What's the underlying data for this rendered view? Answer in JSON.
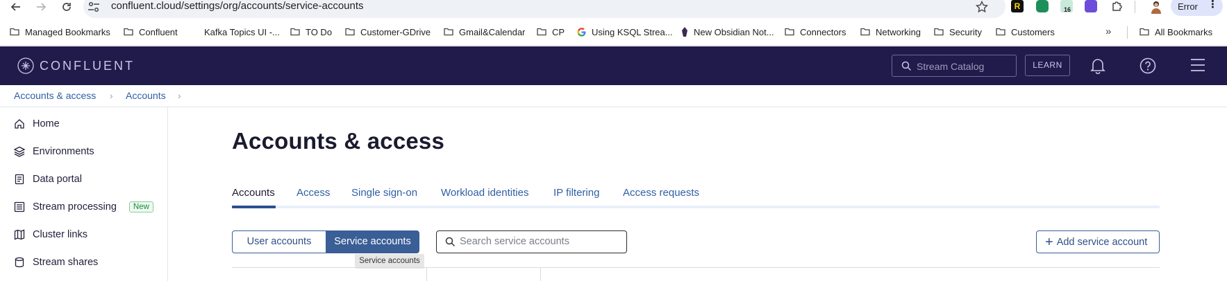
{
  "browser": {
    "url": "confluent.cloud/settings/org/accounts/service-accounts",
    "extension_r_label": "R",
    "extension_badge": "16",
    "error_label": "Error",
    "bookmarks": [
      {
        "label": "Managed Bookmarks",
        "icon": "folder-icon"
      },
      {
        "label": "Confluent",
        "icon": "folder-icon"
      },
      {
        "label": "Kafka Topics UI -...",
        "icon": "page-icon"
      },
      {
        "label": "TO Do",
        "icon": "folder-icon"
      },
      {
        "label": "Customer-GDrive",
        "icon": "folder-icon"
      },
      {
        "label": "Gmail&Calendar",
        "icon": "folder-icon"
      },
      {
        "label": "CP",
        "icon": "folder-icon"
      },
      {
        "label": "Using KSQL Strea...",
        "icon": "google-icon"
      },
      {
        "label": "New Obsidian Not...",
        "icon": "obsidian-icon"
      },
      {
        "label": "Connectors",
        "icon": "folder-icon"
      },
      {
        "label": "Networking",
        "icon": "folder-icon"
      },
      {
        "label": "Security",
        "icon": "folder-icon"
      },
      {
        "label": "Customers",
        "icon": "folder-icon"
      }
    ],
    "bookmarks_overflow": "»",
    "all_bookmarks_label": "All Bookmarks"
  },
  "header": {
    "brand": "CONFLUENT",
    "search_placeholder": "Stream Catalog",
    "learn_label": "LEARN"
  },
  "breadcrumb": [
    {
      "label": "Accounts & access"
    },
    {
      "label": "Accounts"
    }
  ],
  "breadcrumb_separator": "›",
  "sidebar": {
    "items": [
      {
        "label": "Home",
        "icon": "home-icon"
      },
      {
        "label": "Environments",
        "icon": "layers-icon"
      },
      {
        "label": "Data portal",
        "icon": "document-icon"
      },
      {
        "label": "Stream processing",
        "icon": "list-icon",
        "badge": "New"
      },
      {
        "label": "Cluster links",
        "icon": "map-icon"
      },
      {
        "label": "Stream shares",
        "icon": "database-icon"
      }
    ]
  },
  "main": {
    "title": "Accounts & access",
    "tabs": [
      {
        "label": "Accounts",
        "active": true
      },
      {
        "label": "Access"
      },
      {
        "label": "Single sign-on"
      },
      {
        "label": "Workload identities"
      },
      {
        "label": "IP filtering"
      },
      {
        "label": "Access requests"
      }
    ],
    "segment": {
      "user_label": "User accounts",
      "service_label": "Service accounts",
      "selected": "Service accounts"
    },
    "tooltip": "Service accounts",
    "search_placeholder": "Search service accounts",
    "add_button_label": "Add service account",
    "add_button_icon": "plus-icon"
  },
  "colors": {
    "header_bg": "#211b4b",
    "accent": "#3a5e96",
    "link": "#2f5ea5",
    "new_badge": "#1d8a3c"
  }
}
